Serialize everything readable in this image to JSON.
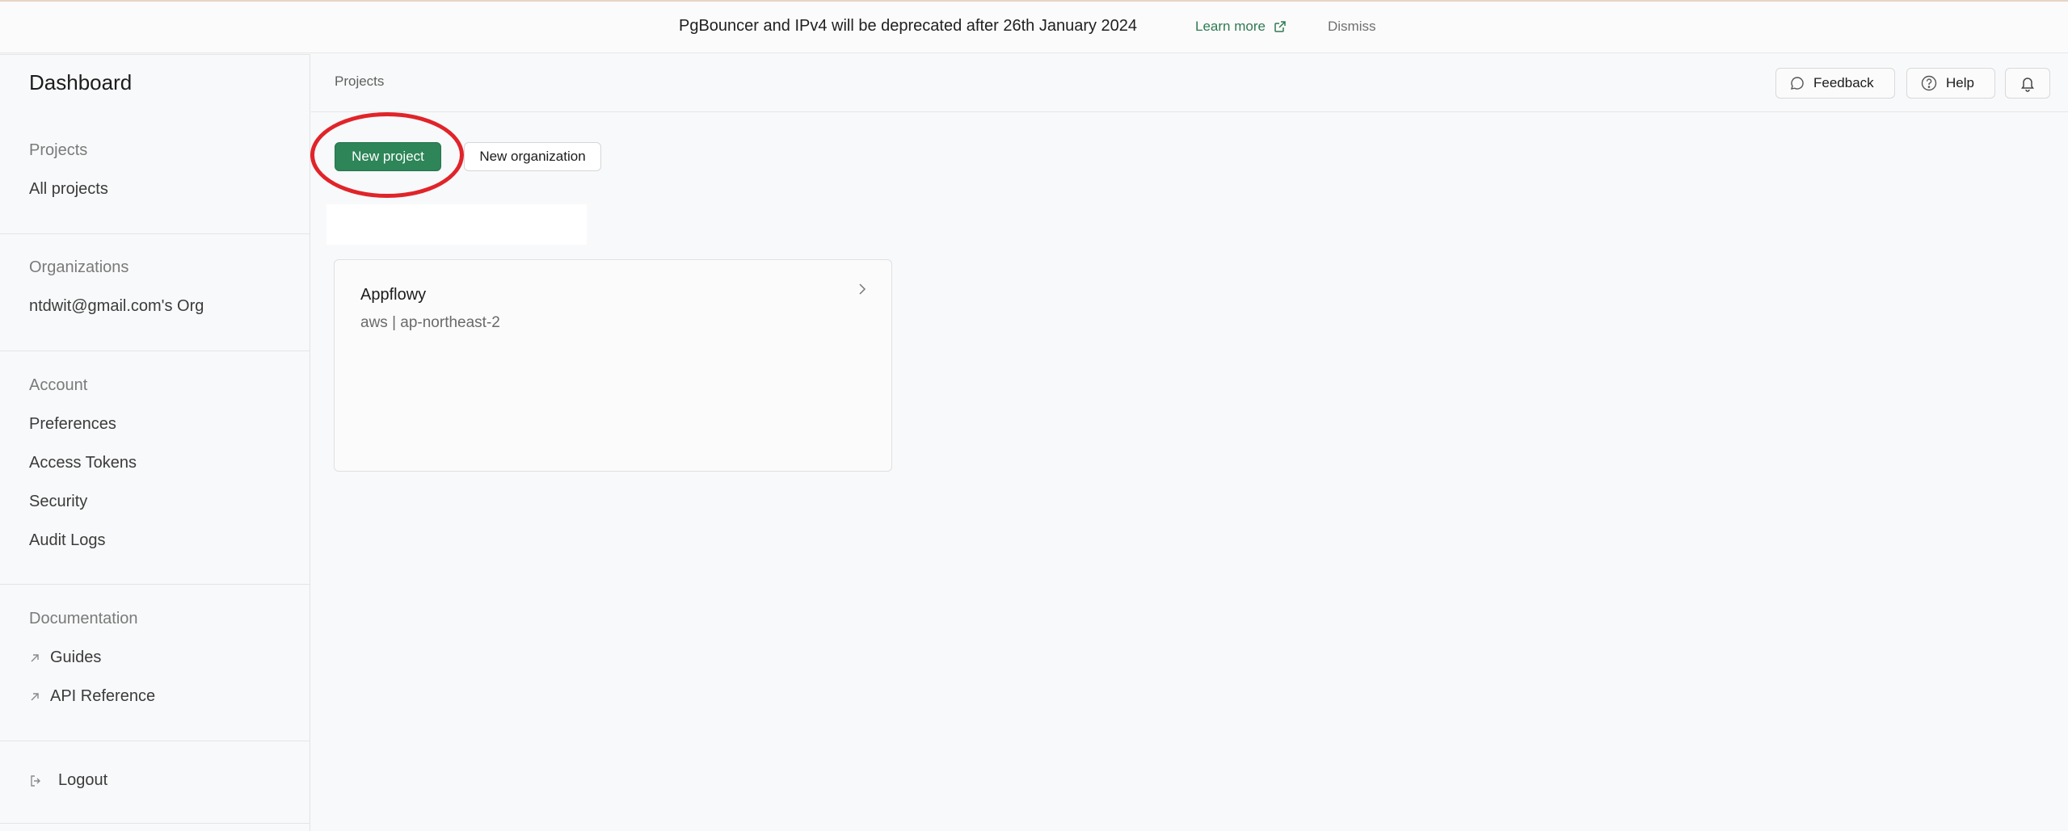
{
  "banner": {
    "message": "PgBouncer and IPv4 will be deprecated after 26th January 2024",
    "learn_more": "Learn more",
    "dismiss": "Dismiss",
    "link_color": "#2f7a52"
  },
  "sidebar": {
    "title": "Dashboard",
    "projects_heading": "Projects",
    "all_projects": "All projects",
    "organizations_heading": "Organizations",
    "org_item": "ntdwit@gmail.com's Org",
    "account_heading": "Account",
    "account_items": [
      "Preferences",
      "Access Tokens",
      "Security",
      "Audit Logs"
    ],
    "documentation_heading": "Documentation",
    "doc_items": [
      "Guides",
      "API Reference"
    ],
    "logout": "Logout"
  },
  "topbar": {
    "breadcrumb": "Projects",
    "feedback": "Feedback",
    "help": "Help",
    "notification_icon": "bell-icon"
  },
  "actions": {
    "new_project": "New project",
    "new_organization": "New organization",
    "primary_color": "#2d8558",
    "highlight_color": "#e0242a"
  },
  "projects": [
    {
      "name": "Appflowy",
      "region": "aws | ap-northeast-2"
    }
  ]
}
